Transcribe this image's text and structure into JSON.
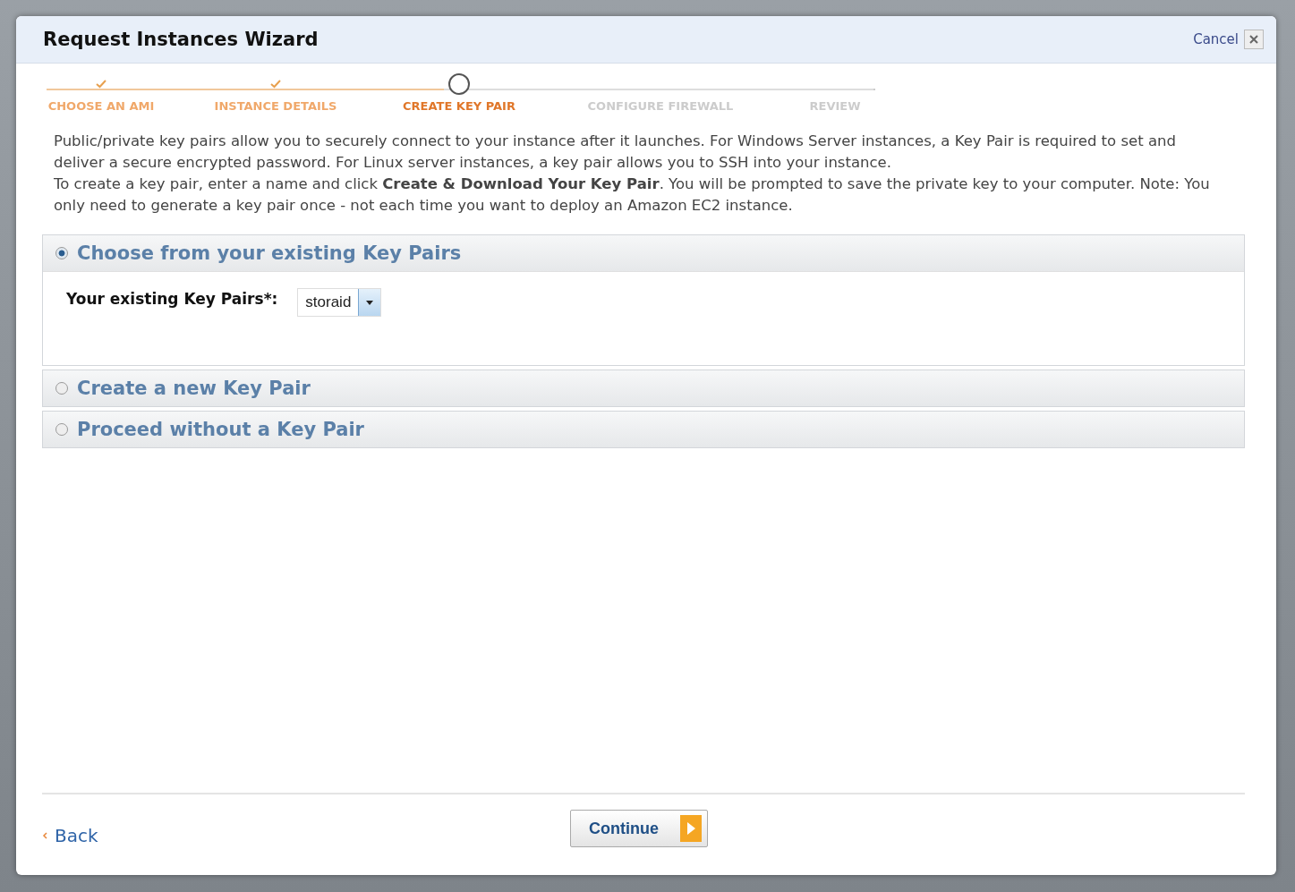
{
  "window": {
    "title": "Request Instances Wizard",
    "cancel": "Cancel"
  },
  "steps": [
    {
      "label": "CHOOSE AN AMI",
      "kind": "done"
    },
    {
      "label": "INSTANCE DETAILS",
      "kind": "done"
    },
    {
      "label": "CREATE KEY PAIR",
      "kind": "current"
    },
    {
      "label": "CONFIGURE FIREWALL",
      "kind": "upcoming"
    },
    {
      "label": "REVIEW",
      "kind": "upcoming"
    }
  ],
  "description": [
    "Public/private key pairs allow you to securely connect to your instance after it launches. For Windows Server instances, a Key Pair is required to set and deliver a secure encrypted password. For Linux server instances, a key pair allows you to SSH into your instance.",
    "To create a key pair, enter a name and click **Create & Download Your Key Pair**. You will be prompted to save the private key to your computer. Note: You only need to generate a key pair once - not each time you want to deploy an Amazon EC2 instance."
  ],
  "options": [
    {
      "label": "Choose from your existing Key Pairs",
      "selected": true,
      "field": {
        "label": "Your existing Key Pairs*:",
        "value": "storaid"
      }
    },
    {
      "label": "Create a new Key Pair",
      "selected": false
    },
    {
      "label": "Proceed without a Key Pair",
      "selected": false
    }
  ],
  "footer": {
    "back": "Back",
    "continue": "Continue"
  }
}
